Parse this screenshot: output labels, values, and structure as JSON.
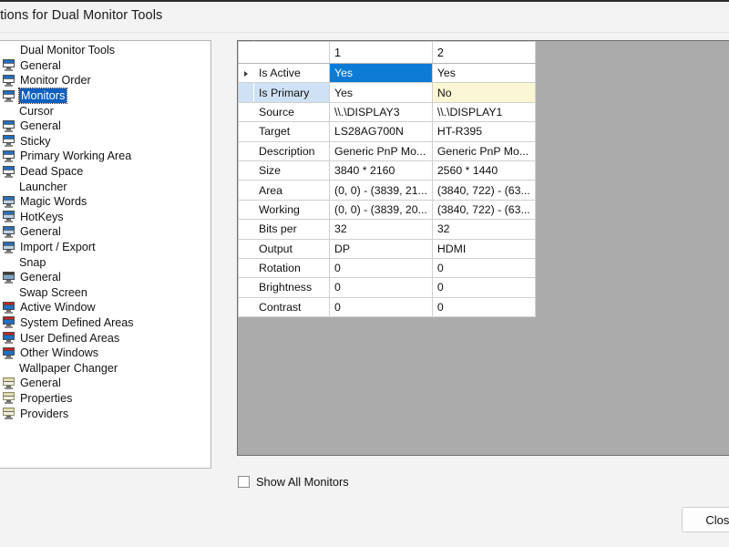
{
  "window": {
    "title": "ptions for Dual Monitor Tools"
  },
  "tree": {
    "items": [
      {
        "label": "Dual Monitor Tools",
        "icon": "none",
        "level": "root",
        "selected": false
      },
      {
        "label": "General",
        "icon": "monitor",
        "level": "child",
        "selected": false
      },
      {
        "label": "Monitor Order",
        "icon": "monitor",
        "level": "child",
        "selected": false
      },
      {
        "label": "Monitors",
        "icon": "monitor",
        "level": "child",
        "selected": true
      },
      {
        "label": "Cursor",
        "icon": "none",
        "level": "group",
        "selected": false
      },
      {
        "label": "General",
        "icon": "monitor",
        "level": "child",
        "selected": false
      },
      {
        "label": "Sticky",
        "icon": "monitor",
        "level": "child",
        "selected": false
      },
      {
        "label": "Primary Working Area",
        "icon": "monitor",
        "level": "child",
        "selected": false
      },
      {
        "label": "Dead Space",
        "icon": "monitor",
        "level": "child",
        "selected": false
      },
      {
        "label": "Launcher",
        "icon": "none",
        "level": "group",
        "selected": false
      },
      {
        "label": "Magic Words",
        "icon": "launcher",
        "level": "child",
        "selected": false
      },
      {
        "label": "HotKeys",
        "icon": "launcher",
        "level": "child",
        "selected": false
      },
      {
        "label": "General",
        "icon": "launcher",
        "level": "child",
        "selected": false
      },
      {
        "label": "Import / Export",
        "icon": "launcher",
        "level": "child",
        "selected": false
      },
      {
        "label": "Snap",
        "icon": "none",
        "level": "group",
        "selected": false
      },
      {
        "label": "General",
        "icon": "snap",
        "level": "child",
        "selected": false
      },
      {
        "label": "Swap Screen",
        "icon": "none",
        "level": "group",
        "selected": false
      },
      {
        "label": "Active Window",
        "icon": "swap",
        "level": "child",
        "selected": false
      },
      {
        "label": "System Defined Areas",
        "icon": "swap",
        "level": "child",
        "selected": false
      },
      {
        "label": "User Defined Areas",
        "icon": "swap",
        "level": "child",
        "selected": false
      },
      {
        "label": "Other Windows",
        "icon": "swap",
        "level": "child",
        "selected": false
      },
      {
        "label": "Wallpaper Changer",
        "icon": "none",
        "level": "group",
        "selected": false
      },
      {
        "label": "General",
        "icon": "wall",
        "level": "child",
        "selected": false
      },
      {
        "label": "Properties",
        "icon": "wall",
        "level": "child",
        "selected": false
      },
      {
        "label": "Providers",
        "icon": "wall",
        "level": "child",
        "selected": false
      }
    ]
  },
  "grid": {
    "headers": [
      "",
      "",
      "1",
      "2"
    ],
    "rows": [
      {
        "name": "Is Active",
        "m1": "Yes",
        "m2": "Yes",
        "current": true,
        "header_hl": false,
        "m1_state": "selected",
        "m2_state": "normal"
      },
      {
        "name": "Is Primary",
        "m1": "Yes",
        "m2": "No",
        "current": false,
        "header_hl": true,
        "m1_state": "normal",
        "m2_state": "warn"
      },
      {
        "name": "Source",
        "m1": "\\\\.\\DISPLAY3",
        "m2": "\\\\.\\DISPLAY1",
        "current": false,
        "header_hl": false,
        "m1_state": "normal",
        "m2_state": "normal"
      },
      {
        "name": "Target",
        "m1": "LS28AG700N",
        "m2": "HT-R395",
        "current": false,
        "header_hl": false,
        "m1_state": "normal",
        "m2_state": "normal"
      },
      {
        "name": "Description",
        "m1": "Generic PnP Mo...",
        "m2": "Generic PnP Mo...",
        "current": false,
        "header_hl": false,
        "m1_state": "normal",
        "m2_state": "normal"
      },
      {
        "name": "Size",
        "m1": "3840 * 2160",
        "m2": "2560 * 1440",
        "current": false,
        "header_hl": false,
        "m1_state": "normal",
        "m2_state": "normal"
      },
      {
        "name": "Area",
        "m1": "(0, 0) - (3839, 21...",
        "m2": "(3840, 722) - (63...",
        "current": false,
        "header_hl": false,
        "m1_state": "normal",
        "m2_state": "normal"
      },
      {
        "name": "Working",
        "m1": "(0, 0) - (3839, 20...",
        "m2": "(3840, 722) - (63...",
        "current": false,
        "header_hl": false,
        "m1_state": "normal",
        "m2_state": "normal"
      },
      {
        "name": "Bits per",
        "m1": "32",
        "m2": "32",
        "current": false,
        "header_hl": false,
        "m1_state": "normal",
        "m2_state": "normal"
      },
      {
        "name": "Output",
        "m1": "DP",
        "m2": "HDMI",
        "current": false,
        "header_hl": false,
        "m1_state": "normal",
        "m2_state": "normal"
      },
      {
        "name": "Rotation",
        "m1": "0",
        "m2": "0",
        "current": false,
        "header_hl": false,
        "m1_state": "normal",
        "m2_state": "normal"
      },
      {
        "name": "Brightness",
        "m1": "0",
        "m2": "0",
        "current": false,
        "header_hl": false,
        "m1_state": "normal",
        "m2_state": "normal"
      },
      {
        "name": "Contrast",
        "m1": "0",
        "m2": "0",
        "current": false,
        "header_hl": false,
        "m1_state": "normal",
        "m2_state": "normal"
      }
    ]
  },
  "footer": {
    "show_all_monitors_label": "Show All Monitors",
    "show_all_monitors_checked": false,
    "close_label": "Close"
  },
  "colors": {
    "accent_selected_cell": "#0c7bd6",
    "tree_selection": "#0c5fbe",
    "row_header_highlight": "#cfe2f5",
    "warn_cell": "#fbf7d5",
    "panel_grey": "#ababab"
  }
}
